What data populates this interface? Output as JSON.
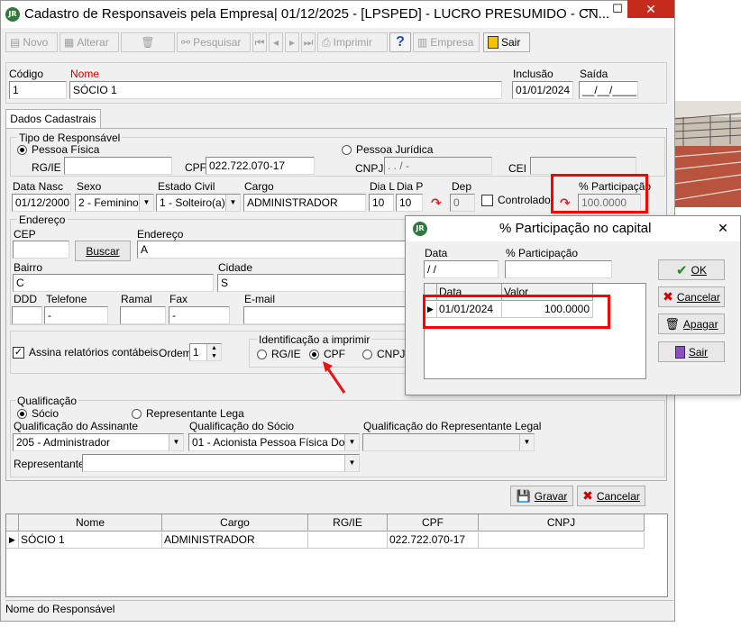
{
  "window": {
    "title": "Cadastro de Responsaveis pela Empresa|  01/12/2025 - [LPSPED] - LUCRO PRESUMIDO - CN...",
    "logo_text": "JR",
    "minimize": "—",
    "maximize": "☐",
    "close": "✕"
  },
  "toolbar": {
    "novo": "Novo",
    "alterar": "Alterar",
    "pesquisar": "Pesquisar",
    "imprimir": "Imprimir",
    "empresa": "Empresa",
    "sair": "Sair"
  },
  "header": {
    "codigo_label": "Código",
    "codigo_value": "1",
    "nome_label": "Nome",
    "nome_value": "SÓCIO 1",
    "inclusao_label": "Inclusão",
    "inclusao_value": "01/01/2024",
    "saida_label": "Saída",
    "saida_value": "__/__/____"
  },
  "tab": "Dados Cadastrais",
  "tipo": {
    "legend": "Tipo de Responsável",
    "pf": "Pessoa Física",
    "pj": "Pessoa Jurídica",
    "rgie_label": "RG/IE",
    "cpf_label": "CPF",
    "cpf_value": "022.722.070-17",
    "cnpj_label": "CNPJ",
    "cnpj_value": ". . / -",
    "cei_label": "CEI"
  },
  "dados": {
    "data_nasc_label": "Data Nasc",
    "data_nasc_value": "01/12/2000",
    "sexo_label": "Sexo",
    "sexo_value": "2 - Feminino",
    "estado_civil_label": "Estado Civil",
    "estado_civil_value": "1 - Solteiro(a)",
    "cargo_label": "Cargo",
    "cargo_value": "ADMINISTRADOR",
    "dia_l_label": "Dia L",
    "dia_l_value": "10",
    "dia_p_label": "Dia P",
    "dia_p_value": "10",
    "dep_label": "Dep",
    "dep_value": "0",
    "controlado_label": "Controlado",
    "participacao_label": "% Participação",
    "participacao_value": "100.0000"
  },
  "endereco": {
    "legend": "Endereço",
    "cep_label": "CEP",
    "buscar": "Buscar",
    "endereco_label": "Endereço",
    "endereco_value": "A",
    "bairro_label": "Bairro",
    "bairro_value": "C",
    "cidade_label": "Cidade",
    "cidade_value": "S",
    "ddd_label": "DDD",
    "telefone_label": "Telefone",
    "telefone_value": "-",
    "ramal_label": "Ramal",
    "fax_label": "Fax",
    "fax_value": "-",
    "email_label": "E-mail"
  },
  "opcoes": {
    "assina_label": "Assina relatórios contábeis",
    "ordem_label": "Ordem",
    "ordem_value": "1",
    "ident_legend": "Identificação a imprimir",
    "rgie": "RG/IE",
    "cpf": "CPF",
    "cnpj": "CNPJ"
  },
  "qualificacao": {
    "legend": "Qualificação",
    "socio": "Sócio",
    "representante_legal": "Representante Lega",
    "assinante_label": "Qualificação do Assinante",
    "assinante_value": "205 - Administrador",
    "socio_label": "Qualificação do Sócio",
    "socio_value": "01 - Acionista Pessoa Física Dom",
    "rep_label": "Qualificação do Representante Legal",
    "representante_label": "Representante"
  },
  "actions": {
    "gravar": "Gravar",
    "cancelar": "Cancelar"
  },
  "grid": {
    "columns": [
      "Nome",
      "Cargo",
      "RG/IE",
      "CPF",
      "CNPJ"
    ],
    "rows": [
      {
        "nome": "SÓCIO 1",
        "cargo": "ADMINISTRADOR",
        "rgie": "",
        "cpf": "022.722.070-17",
        "cnpj": ""
      }
    ]
  },
  "status": "Nome do Responsável",
  "dialog": {
    "title": "% Participação no capital",
    "close": "✕",
    "data_label": "Data",
    "data_value": " / /",
    "participacao_label": "% Participação",
    "columns": [
      "Data",
      "Valor"
    ],
    "rows": [
      {
        "data": "01/01/2024",
        "valor": "100.0000"
      }
    ],
    "ok": "OK",
    "cancelar": "Cancelar",
    "apagar": "Apagar",
    "sair": "Sair"
  }
}
